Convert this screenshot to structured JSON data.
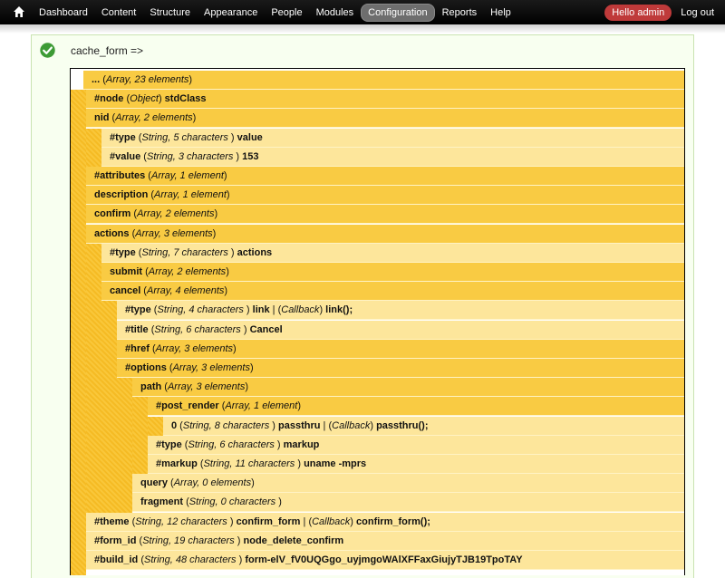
{
  "toolbar": {
    "nav": [
      "Dashboard",
      "Content",
      "Structure",
      "Appearance",
      "People",
      "Modules",
      "Configuration",
      "Reports",
      "Help"
    ],
    "active": "Configuration",
    "hello": "Hello admin",
    "logout": "Log out"
  },
  "message": {
    "title": "cache_form =>"
  },
  "rows": [
    {
      "depth": 0,
      "key": "...",
      "type": "Array, 23 elements",
      "value": "",
      "bg": "y"
    },
    {
      "depth": 1,
      "key": "#node",
      "type": "Object",
      "value": "stdClass",
      "bg": "y"
    },
    {
      "depth": 1,
      "key": "nid",
      "type": "Array, 2 elements",
      "value": "",
      "bg": "y"
    },
    {
      "depth": 2,
      "key": "#type",
      "type": "String, 5 characters ",
      "value": "value",
      "bg": "l"
    },
    {
      "depth": 2,
      "key": "#value",
      "type": "String, 3 characters ",
      "value": "153",
      "bg": "l"
    },
    {
      "depth": 1,
      "key": "#attributes",
      "type": "Array, 1 element",
      "value": "",
      "bg": "y"
    },
    {
      "depth": 1,
      "key": "description",
      "type": "Array, 1 element",
      "value": "",
      "bg": "y"
    },
    {
      "depth": 1,
      "key": "confirm",
      "type": "Array, 2 elements",
      "value": "",
      "bg": "y"
    },
    {
      "depth": 1,
      "key": "actions",
      "type": "Array, 3 elements",
      "value": "",
      "bg": "y"
    },
    {
      "depth": 2,
      "key": "#type",
      "type": "String, 7 characters ",
      "value": "actions",
      "bg": "l"
    },
    {
      "depth": 2,
      "key": "submit",
      "type": "Array, 2 elements",
      "value": "",
      "bg": "y"
    },
    {
      "depth": 2,
      "key": "cancel",
      "type": "Array, 4 elements",
      "value": "",
      "bg": "y"
    },
    {
      "depth": 3,
      "key": "#type",
      "type": "String, 4 characters ",
      "value": "link",
      "cb": "link();",
      "bg": "l"
    },
    {
      "depth": 3,
      "key": "#title",
      "type": "String, 6 characters ",
      "value": "Cancel",
      "bg": "l"
    },
    {
      "depth": 3,
      "key": "#href",
      "type": "Array, 3 elements",
      "value": "",
      "bg": "y"
    },
    {
      "depth": 3,
      "key": "#options",
      "type": "Array, 3 elements",
      "value": "",
      "bg": "y"
    },
    {
      "depth": 4,
      "key": "path",
      "type": "Array, 3 elements",
      "value": "",
      "bg": "y"
    },
    {
      "depth": 5,
      "key": "#post_render",
      "type": "Array, 1 element",
      "value": "",
      "bg": "y"
    },
    {
      "depth": 6,
      "key": "0",
      "type": "String, 8 characters ",
      "value": "passthru",
      "cb": "passthru();",
      "bg": "l"
    },
    {
      "depth": 5,
      "key": "#type",
      "type": "String, 6 characters ",
      "value": "markup",
      "bg": "l"
    },
    {
      "depth": 5,
      "key": "#markup",
      "type": "String, 11 characters ",
      "value": "uname -mprs",
      "bg": "l"
    },
    {
      "depth": 4,
      "key": "query",
      "type": "Array, 0 elements",
      "value": "",
      "bg": "l"
    },
    {
      "depth": 4,
      "key": "fragment",
      "type": "String, 0 characters ",
      "value": "",
      "bg": "l"
    },
    {
      "depth": 1,
      "key": "#theme",
      "type": "String, 12 characters ",
      "value": "confirm_form",
      "cb": "confirm_form();",
      "bg": "l"
    },
    {
      "depth": 1,
      "key": "#form_id",
      "type": "String, 19 characters ",
      "value": "node_delete_confirm",
      "bg": "l"
    },
    {
      "depth": 1,
      "key": "#build_id",
      "type": "String, 48 characters ",
      "value": "form-elV_fV0UQGgo_uyjmgoWAlXFFaxGiujyTJB19TpoTAY",
      "bg": "l"
    }
  ],
  "callback_label": "Callback",
  "colors": {
    "row_dark": "#f9cb43",
    "row_light": "#fde69b",
    "toolbar": "#000000",
    "hello": "#bf3a3a",
    "ok": "#3d9b35"
  }
}
